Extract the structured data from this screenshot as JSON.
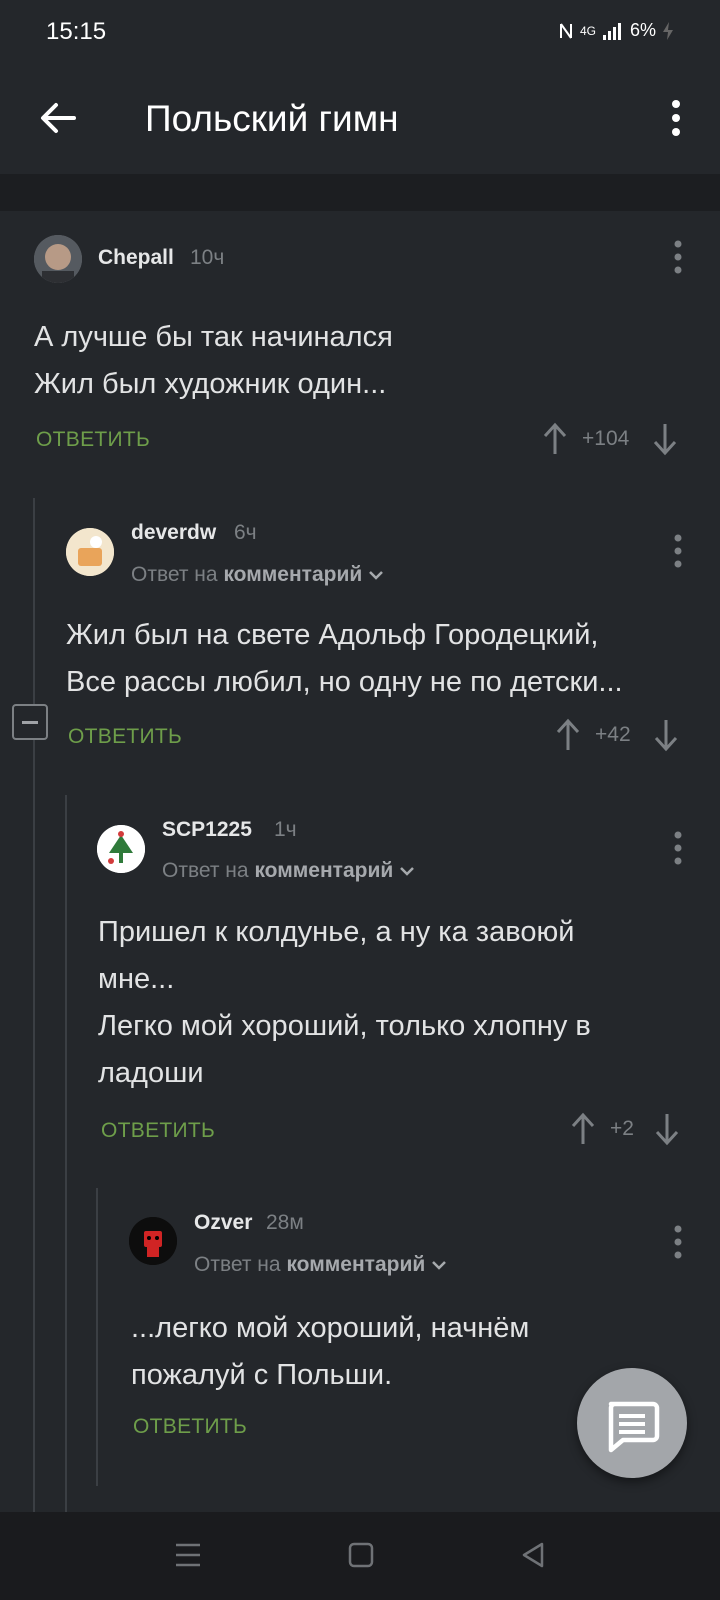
{
  "status_bar": {
    "time": "15:15",
    "network": "4G",
    "battery": "6%"
  },
  "app_bar": {
    "title": "Польский гимн",
    "back_icon": "arrow-left-icon",
    "menu_icon": "more-vertical-icon"
  },
  "comments": [
    {
      "author": "Chepall",
      "age": "10ч",
      "reply_to": "",
      "lines": [
        "А лучше бы так начинался",
        "Жил был художник один..."
      ],
      "reply_label": "ОТВЕТИТЬ",
      "score": "+104"
    },
    {
      "author": "deverdw",
      "age": "6ч",
      "reply_to_prefix": "Ответ на",
      "reply_to": "комментарий",
      "lines": [
        "Жил был на свете Адольф Городецкий,",
        "Все рассы любил, но одну не по детски..."
      ],
      "reply_label": "ОТВЕТИТЬ",
      "score": "+42"
    },
    {
      "author": "SCP1225",
      "age": "1ч",
      "reply_to_prefix": "Ответ на",
      "reply_to": "комментарий",
      "lines": [
        "Пришел к колдунье, а ну ка завоюй",
        "мне...",
        "Легко мой хороший, только хлопну в",
        "ладоши"
      ],
      "reply_label": "ОТВЕТИТЬ",
      "score": "+2"
    },
    {
      "author": "Ozver",
      "age": "28м",
      "reply_to_prefix": "Ответ на",
      "reply_to": "комментарий",
      "lines": [
        "...легко мой хороший, начнём",
        "пожалуй с Польши."
      ],
      "reply_label": "ОТВЕТИТЬ",
      "score": ""
    }
  ],
  "colors": {
    "background": "#24272b",
    "accent_green": "#6e9e4a",
    "muted": "#7c8084",
    "fab": "#a3a6aa"
  },
  "fab_icon": "comment-icon",
  "nav_icons": [
    "menu-icon",
    "home-square-icon",
    "back-triangle-icon"
  ]
}
